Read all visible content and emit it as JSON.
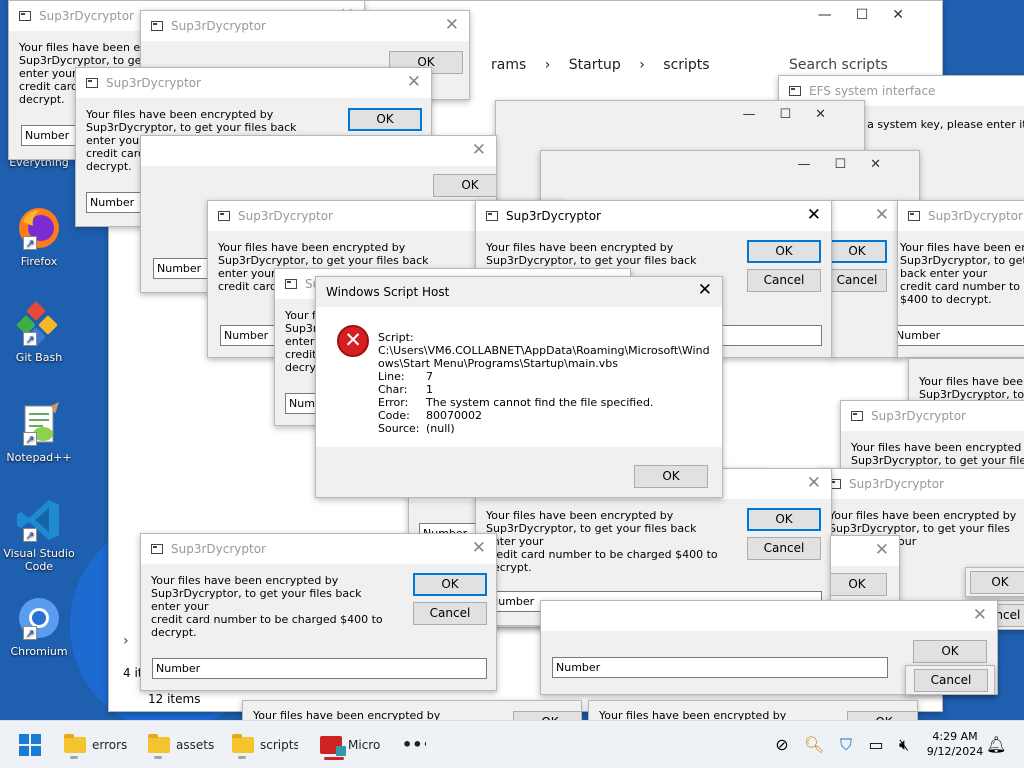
{
  "ransom": {
    "title": "Sup3rDycryptor",
    "line1": "Your files have been encrypted by",
    "line2": "Sup3rDycryptor, to get your files back enter your",
    "line3": "credit card number to be charged $400 to decrypt.",
    "line3_short": "credit card n",
    "ok": "OK",
    "cancel": "Cancel",
    "input_value": "Number"
  },
  "explorer": {
    "breadcrumb_programs": "rams",
    "breadcrumb_startup": "Startup",
    "breadcrumb_scripts": "scripts",
    "search_placeholder": "Search scripts",
    "item_count": "12 items",
    "item_count_partial": "4 it"
  },
  "efs": {
    "title": "EFS system interface",
    "text_line1": "iring a system key, please enter it",
    "text_line2": "."
  },
  "wsh": {
    "title": "Windows Script Host",
    "script_label": "Script:",
    "script_path1": "C:\\Users\\VM6.COLLABNET\\AppData\\Roaming\\Microsoft\\Wind",
    "script_path2": "ows\\Start Menu\\Programs\\Startup\\main.vbs",
    "line_label": "Line:",
    "line_value": "7",
    "char_label": "Char:",
    "char_value": "1",
    "error_label": "Error:",
    "error_value": "The system cannot find the file specified.",
    "code_label": "Code:",
    "code_value": "80070002",
    "source_label": "Source:",
    "source_value": "(null)",
    "ok": "OK"
  },
  "desktop_icons": [
    {
      "label": "Everything"
    },
    {
      "label": "Firefox"
    },
    {
      "label": "Git Bash"
    },
    {
      "label": "Notepad++"
    },
    {
      "label": "Visual Studio Code"
    },
    {
      "label": "Chromium"
    }
  ],
  "taskbar": {
    "items": [
      {
        "label": "errors"
      },
      {
        "label": "assets"
      },
      {
        "label": "scripts"
      },
      {
        "label": "Micro"
      }
    ],
    "time": "4:29 AM",
    "date": "9/12/2024"
  }
}
